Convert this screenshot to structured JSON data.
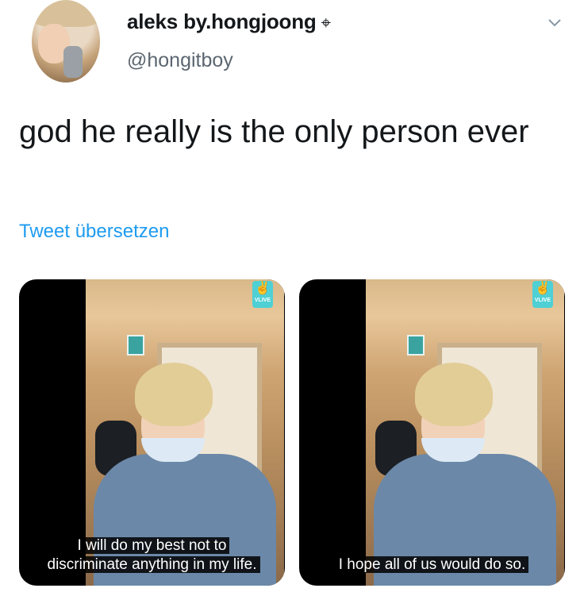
{
  "author": {
    "display_name": "aleks by.hongjoong",
    "badge": "⌖",
    "handle": "@hongitboy"
  },
  "tweet": {
    "text": "god he really is the only person ever",
    "translate_label": "Tweet übersetzen"
  },
  "media": [
    {
      "watermark": "VLIVE",
      "caption_line1": "I will do my best not to",
      "caption_line2": "discriminate anything in my life."
    },
    {
      "watermark": "VLIVE",
      "caption_line1": "I hope all of us would do so.",
      "caption_line2": ""
    }
  ],
  "colors": {
    "link": "#1d9bf0",
    "handle": "#5b6670",
    "text": "#14171a"
  },
  "icons": {
    "more": "chevron-down-icon",
    "badge": "crosshair-icon"
  }
}
